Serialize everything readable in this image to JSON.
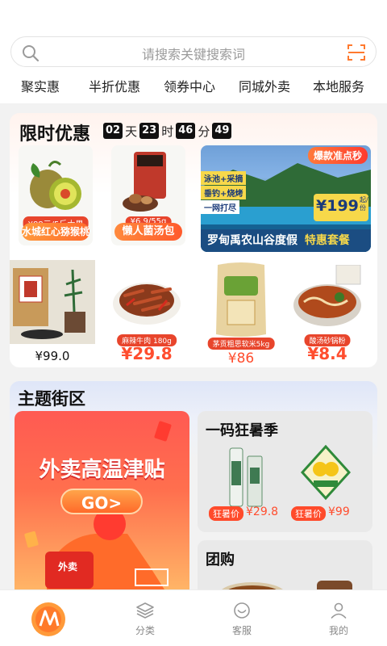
{
  "search": {
    "placeholder": "请搜索关键搜索词"
  },
  "nav": [
    "聚实惠",
    "半折优惠",
    "领券中心",
    "同城外卖",
    "本地服务"
  ],
  "flash_sale": {
    "title": "限时优惠",
    "timer": {
      "days": "02",
      "day_unit": "天",
      "hours": "23",
      "hour_unit": "时",
      "minutes": "46",
      "minute_unit": "分",
      "seconds": "49"
    },
    "top_products": [
      {
        "tag": "¥88元/5斤大果",
        "name": "水城红心猕猴桃"
      },
      {
        "tag": "¥6.9/55g",
        "name": "懒人菌汤包"
      }
    ],
    "resort": {
      "badge": "爆款准点秒",
      "lines": [
        "泳池+采摘",
        "垂钓+烧烤",
        "一网打尽"
      ],
      "price": "¥199",
      "price_unit": "起/份",
      "caption": "罗甸禹农山谷度假",
      "caption_highlight": "特惠套餐"
    },
    "bottom_products": [
      {
        "price": "¥99.0"
      },
      {
        "tag": "麻辣牛肉 180g",
        "price": "¥29.8"
      },
      {
        "tag": "茅贡粗思软米5kg",
        "price": "¥86"
      },
      {
        "tag": "酸汤砂锅粉",
        "price": "¥8.4"
      }
    ]
  },
  "theme": {
    "title": "主题街区",
    "waimai": {
      "headline": "外卖高温津贴",
      "go": "GO>",
      "box_label": "外卖"
    },
    "summer": {
      "title": "一码狂暑季",
      "items": [
        {
          "tag": "狂暑价",
          "price": "¥29.8"
        },
        {
          "tag": "狂暑价",
          "price": "¥99"
        }
      ]
    },
    "group": {
      "title": "团购"
    }
  },
  "tabbar": [
    {
      "label": "",
      "icon": "home-logo-icon"
    },
    {
      "label": "分类",
      "icon": "layers-icon"
    },
    {
      "label": "客服",
      "icon": "service-icon"
    },
    {
      "label": "我的",
      "icon": "person-icon"
    }
  ],
  "colors": {
    "accent": "#ff4d2e",
    "scan": "#ff7a2f",
    "tab_active": "#ff7a2f"
  }
}
